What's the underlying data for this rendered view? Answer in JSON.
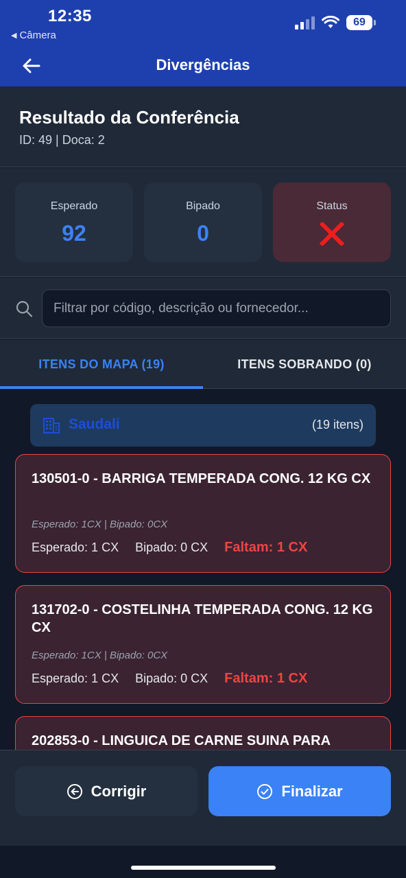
{
  "status_bar": {
    "time": "12:35",
    "back_app": "Câmera",
    "battery": "69"
  },
  "app_bar": {
    "title": "Divergências",
    "back_icon": "arrow-left-icon"
  },
  "header": {
    "title": "Resultado da Conferência",
    "subtitle": "ID: 49 | Doca: 2"
  },
  "stats": {
    "expected_label": "Esperado",
    "expected_value": "92",
    "scanned_label": "Bipado",
    "scanned_value": "0",
    "status_label": "Status",
    "status_icon": "red-x-icon"
  },
  "search": {
    "placeholder": "Filtrar por código, descrição ou fornecedor...",
    "value": ""
  },
  "tabs": [
    {
      "label": "ITENS DO MAPA (19)",
      "active": true
    },
    {
      "label": "ITENS SOBRANDO (0)",
      "active": false
    }
  ],
  "supplier": {
    "name": "Saudali",
    "count": "(19 itens)"
  },
  "items": [
    {
      "title": "130501-0 - BARRIGA TEMPERADA CONG. 12 KG CX",
      "detail": "Esperado: 1CX | Bipado: 0CX",
      "expected": "Esperado: 1 CX",
      "scanned": "Bipado: 0 CX",
      "missing": "Faltam: 1 CX"
    },
    {
      "title": "131702-0 - COSTELINHA TEMPERADA CONG. 12 KG CX",
      "detail": "Esperado: 1CX | Bipado: 0CX",
      "expected": "Esperado: 1 CX",
      "scanned": "Bipado: 0 CX",
      "missing": "Faltam: 1 CX"
    },
    {
      "title": "202853-0 - LINGUICA DE CARNE SUINA PARA"
    }
  ],
  "actions": {
    "correct_label": "Corrigir",
    "finish_label": "Finalizar"
  },
  "colors": {
    "primary": "#3b82f6",
    "app_bar": "#1e40af",
    "danger": "#ef4444"
  }
}
